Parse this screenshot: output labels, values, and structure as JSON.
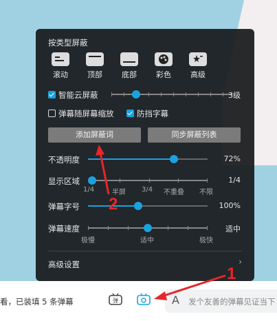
{
  "panel": {
    "section_title": "按类型屏蔽",
    "block_types": [
      {
        "label": "滚动",
        "icon": "scroll-danmaku-icon"
      },
      {
        "label": "顶部",
        "icon": "top-danmaku-icon"
      },
      {
        "label": "底部",
        "icon": "bottom-danmaku-icon"
      },
      {
        "label": "彩色",
        "icon": "palette-icon"
      },
      {
        "label": "高级",
        "icon": "star-danmaku-icon"
      }
    ],
    "smart_block": {
      "label": "智能云屏蔽",
      "checked": true,
      "value": "3级",
      "level": 3,
      "max": 10
    },
    "scale_with_screen": {
      "label": "弹幕随屏幕缩放",
      "checked": false
    },
    "anti_block": {
      "label": "防挡字幕",
      "checked": true
    },
    "add_word_button": "添加屏蔽词",
    "sync_list_button": "同步屏蔽列表",
    "opacity": {
      "label": "不透明度",
      "value": "72%",
      "fraction": 0.72
    },
    "display_area": {
      "label": "显示区域",
      "value": "1/4",
      "options": [
        "1/4",
        "半屏",
        "3/4",
        "不重叠",
        "不限"
      ],
      "selected_index": 0
    },
    "font_size": {
      "label": "弹幕字号",
      "value": "100%",
      "fraction": 0.42
    },
    "speed": {
      "label": "弹幕速度",
      "value": "适中",
      "options": [
        "极慢",
        "适中",
        "极快"
      ],
      "fraction": 0.5
    },
    "advanced_label": "高级设置"
  },
  "bottom_bar": {
    "status_text": "看，已装填 5 条弹幕",
    "input_placeholder": "发个友善的弹幕见证当下"
  },
  "annotations": {
    "one": "1",
    "two": "2"
  },
  "colors": {
    "accent": "#1aa2e0",
    "annotation": "#e8252b"
  }
}
